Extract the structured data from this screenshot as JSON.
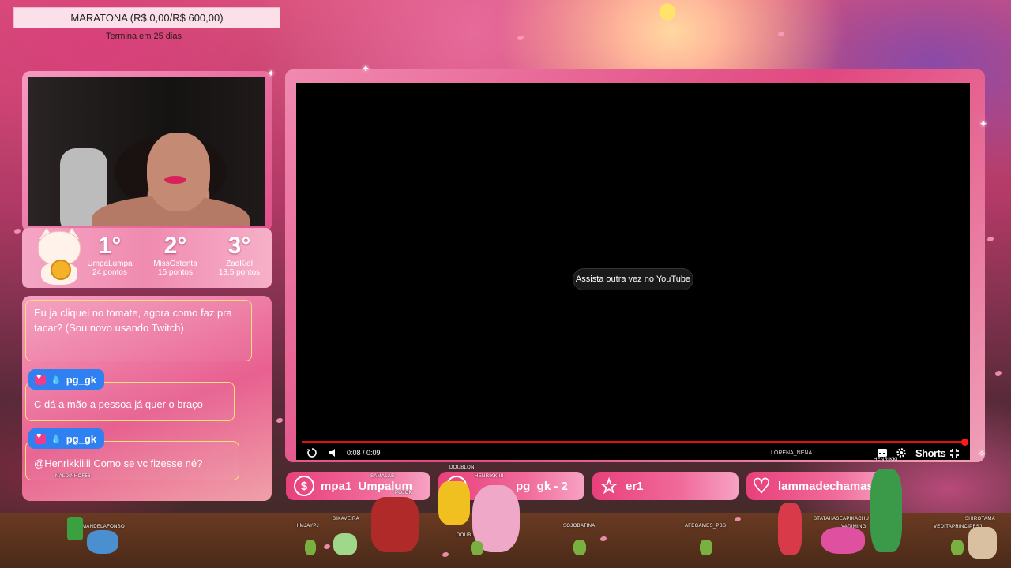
{
  "marathon": {
    "label": "MARATONA (R$ 0,00/R$ 600,00)",
    "ends": "Termina em 25 dias"
  },
  "ranking": [
    {
      "place": "1°",
      "name": "UmpaLumpa",
      "points": "24 pontos"
    },
    {
      "place": "2°",
      "name": "MissOstenta",
      "points": "15 pontos"
    },
    {
      "place": "3°",
      "name": "ZadKiel",
      "points": "13.5 pontos"
    }
  ],
  "chat": {
    "messages": [
      {
        "user": "",
        "text": "Eu ja cliquei no tomate, agora como faz pra tacar? (Sou novo usando Twitch)"
      },
      {
        "user": "pg_gk",
        "text": "C dá a mão a pessoa já quer o braço"
      },
      {
        "user": "pg_gk",
        "text": "@Henrikkiiiii Como se vc fizesse né?"
      }
    ]
  },
  "video": {
    "youtube_message": "Assista outra vez no YouTube",
    "time": "0:08 / 0:09",
    "progress": 0.99,
    "channel_name": "LORENA_NENA",
    "shorts_label": "Shorts"
  },
  "bottom_bar": [
    {
      "icon": "dollar-icon",
      "text": "mpa1  Umpalum"
    },
    {
      "icon": "diamond-icon",
      "text": "pg_gk - 2"
    },
    {
      "icon": "star-icon",
      "text": "er1"
    },
    {
      "icon": "heart-icon",
      "text": "lammadechamas"
    }
  ],
  "viewers": {
    "top_row": [
      "DOUBLON",
      "SAMALAB",
      "HENRIKKIIII",
      "POJOK"
    ],
    "bottom_row": [
      "NALDINHOF58",
      "MANDELAFONSO",
      "HIMJAYPJ",
      "BIKAVEIRA",
      "DOUBLECAR18IA",
      "SOJOBATINA",
      "AFEGAMES_PBS",
      "STATAHASEAPIKACHU",
      "VADIMING",
      "HENRIKKI",
      "VEDITAPRINCIPESJ",
      "SHIROTAMA"
    ]
  },
  "colors": {
    "accent_pink": "#e8407a",
    "chat_badge": "#2f80f0",
    "progress": "#e01010"
  }
}
